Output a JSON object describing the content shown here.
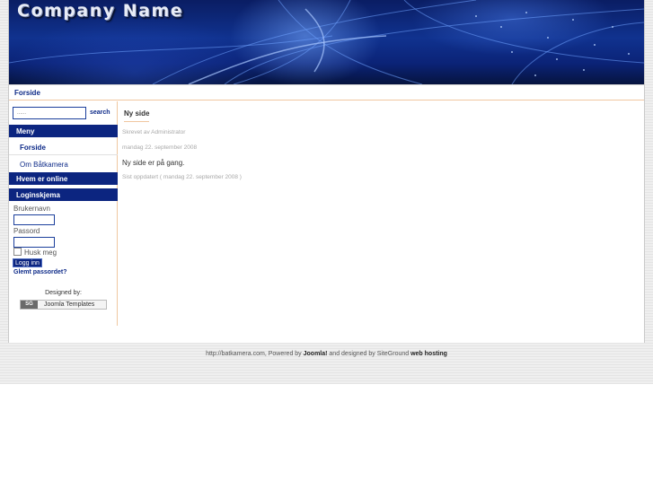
{
  "header": {
    "logo_text": "Company Name"
  },
  "breadcrumb": {
    "current": "Forside"
  },
  "search": {
    "placeholder": "......",
    "button_label": "search"
  },
  "menu": {
    "title": "Meny",
    "items": [
      {
        "label": "Forside"
      },
      {
        "label": "Om Båtkamera"
      }
    ]
  },
  "who_online": {
    "title": "Hvem er online"
  },
  "login": {
    "title": "Loginskjema",
    "username_label": "Brukernavn",
    "password_label": "Passord",
    "remember_label": "Husk meg",
    "submit_label": "Logg inn",
    "forgot_label": "Glemt passordet?"
  },
  "credits": {
    "designed_by": "Designed by:",
    "sg_logo": "SG",
    "badge_text": "Joomla Templates"
  },
  "article": {
    "title": "Ny side",
    "author": "Skrevet av Administrator",
    "date": "mandag 22. september 2008",
    "body": "Ny  side er på gang.",
    "updated": "Sist oppdatert ( mandag 22. september 2008 )"
  },
  "footer": {
    "prefix": "http://batkamera.com, Powered by ",
    "joomla": "Joomla!",
    "middle": " and designed by SiteGround ",
    "hosting": "web hosting"
  },
  "colors": {
    "nav_blue": "#0c2580",
    "link_blue": "#0d2a88",
    "accent_orange": "#f0c7a0"
  }
}
